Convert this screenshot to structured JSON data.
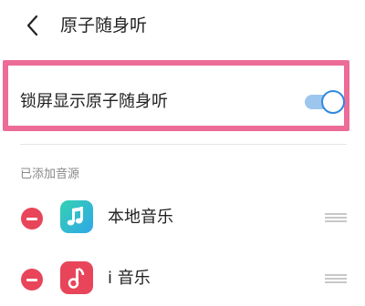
{
  "header": {
    "title": "原子随身听"
  },
  "setting": {
    "label": "锁屏显示原子随身听",
    "enabled": true
  },
  "section": {
    "title": "已添加音源"
  },
  "sources": [
    {
      "name": "本地音乐",
      "icon": "music-note-icon"
    },
    {
      "name": "i 音乐",
      "icon": "i-music-logo-icon"
    }
  ],
  "colors": {
    "highlight_border": "#ec6c97",
    "toggle_track": "#9dc6ee",
    "toggle_knob_border": "#2f89df",
    "remove_button": "#e8455a"
  }
}
